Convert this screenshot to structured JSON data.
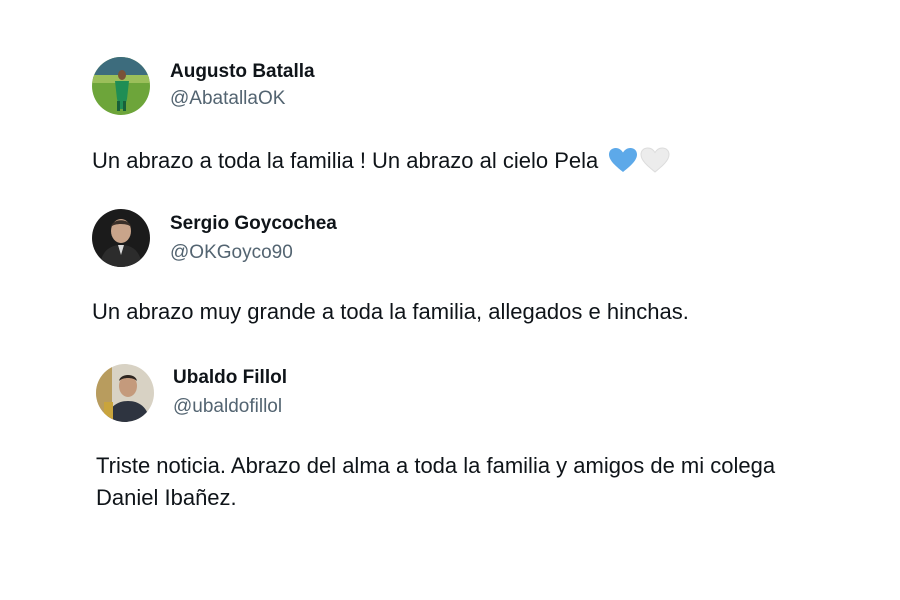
{
  "tweets": [
    {
      "name": "Augusto Batalla",
      "handle": "@AbatallaOK",
      "text": "Un abrazo a toda la familia ! Un abrazo al cielo Pela",
      "emojis": [
        "blue-heart-icon",
        "white-heart-icon"
      ]
    },
    {
      "name": "Sergio Goycochea",
      "handle": "@OKGoyco90",
      "text": "Un abrazo muy grande a toda la familia, allegados e hinchas."
    },
    {
      "name": "Ubaldo Fillol",
      "handle": "@ubaldofillol",
      "text_line1": "Triste noticia. Abrazo del alma a toda la familia y amigos de mi colega",
      "text_line2": "Daniel Ibañez."
    }
  ],
  "colors": {
    "name": "#0f1419",
    "handle": "#536471",
    "blue_heart": "#5da9e9",
    "white_heart": "#e9e9e9"
  }
}
